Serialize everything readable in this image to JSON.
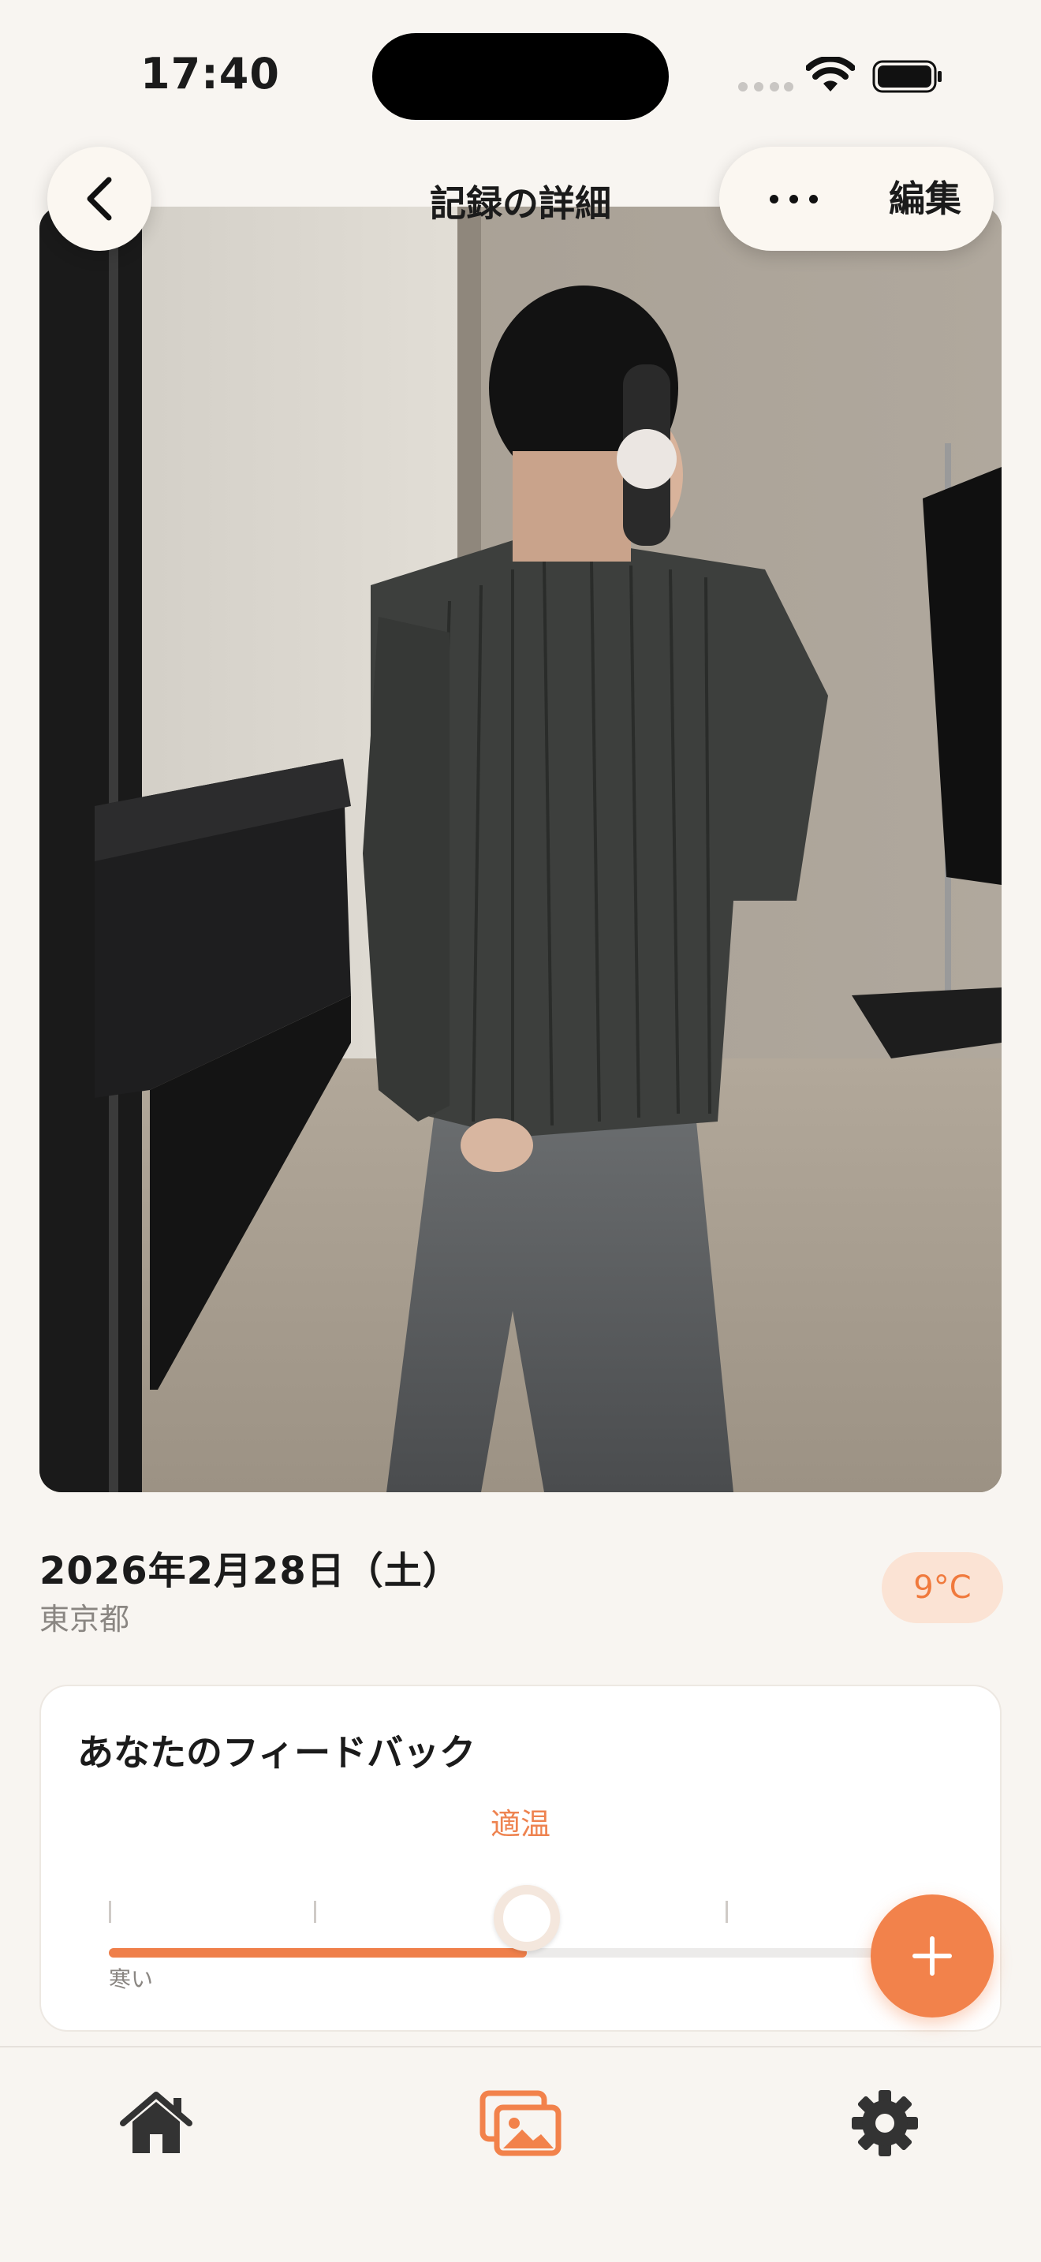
{
  "status_bar": {
    "time": "17:40"
  },
  "nav": {
    "title": "記録の詳細",
    "edit_label": "編集"
  },
  "photo": {
    "description_icon": "outfit-photo"
  },
  "record": {
    "date": "2026年2月28日（土）",
    "location": "東京都",
    "temperature": "9°C"
  },
  "feedback": {
    "title": "あなたのフィードバック",
    "value_label": "適温",
    "scale_min_label": "寒い",
    "level": 0.5
  },
  "colors": {
    "accent": "#f2824b",
    "background": "#f8f5f1",
    "card": "#ffffff",
    "temp_badge_bg": "#fbe3d4"
  },
  "tabs": [
    {
      "icon": "home-icon",
      "active": false
    },
    {
      "icon": "photos-icon",
      "active": true
    },
    {
      "icon": "gear-icon",
      "active": false
    }
  ]
}
